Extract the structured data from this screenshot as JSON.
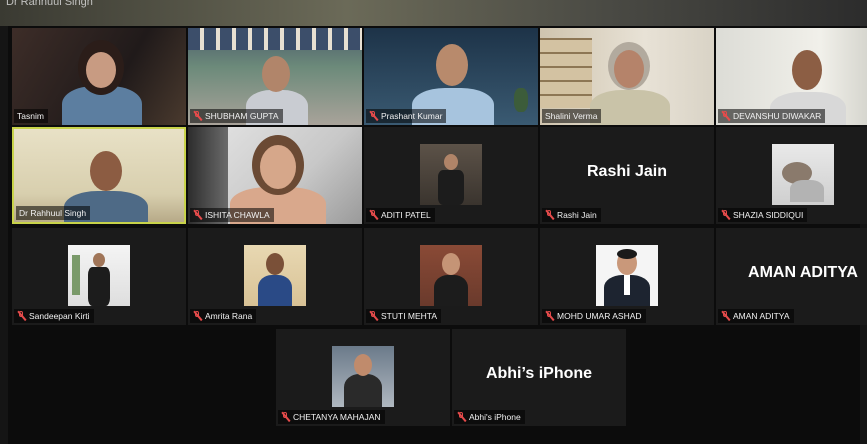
{
  "meeting": {
    "top_label": "Dr Rahhuul Singh"
  },
  "participants": [
    {
      "name": "Tasnim",
      "muted": false,
      "type": "video"
    },
    {
      "name": "SHUBHAM GUPTA",
      "muted": true,
      "type": "video"
    },
    {
      "name": "Prashant Kumar",
      "muted": true,
      "type": "video"
    },
    {
      "name": "Shalini Verma",
      "muted": false,
      "type": "video"
    },
    {
      "name": "DEVANSHU DIWAKAR",
      "muted": true,
      "type": "video"
    },
    {
      "name": "Dr Rahhuul Singh",
      "muted": false,
      "type": "video",
      "active_speaker": true
    },
    {
      "name": "ISHITA CHAWLA",
      "muted": true,
      "type": "video"
    },
    {
      "name": "ADITI PATEL",
      "muted": true,
      "type": "photo"
    },
    {
      "name": "Rashi Jain",
      "muted": true,
      "type": "name",
      "display": "Rashi Jain"
    },
    {
      "name": "SHAZIA SIDDIQUI",
      "muted": true,
      "type": "photo"
    },
    {
      "name": "Sandeepan Kirti",
      "muted": true,
      "type": "photo"
    },
    {
      "name": "Amrita Rana",
      "muted": true,
      "type": "photo"
    },
    {
      "name": "STUTI MEHTA",
      "muted": true,
      "type": "photo"
    },
    {
      "name": "MOHD UMAR ASHAD",
      "muted": true,
      "type": "photo"
    },
    {
      "name": "AMAN ADITYA",
      "muted": true,
      "type": "name",
      "display": "AMAN ADITYA"
    },
    {
      "name": "CHETANYA MAHAJAN",
      "muted": true,
      "type": "photo"
    },
    {
      "name": "Abhi's iPhone",
      "muted": true,
      "type": "name",
      "display": "Abhi’s iPhone"
    }
  ],
  "colors": {
    "active_border": "#c8d34a",
    "mute_icon": "#e54b4b",
    "tile_bg": "#1b1b1b"
  }
}
